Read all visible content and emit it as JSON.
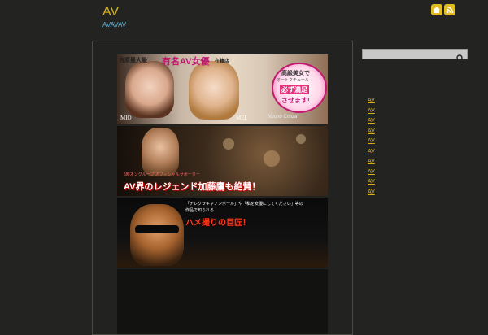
{
  "header": {
    "title": "AV",
    "tagline": "AVAVAV"
  },
  "icons": [
    "home-icon",
    "rss-icon"
  ],
  "banners": [
    {
      "headline_left": "吉原最大級",
      "headline_main": "有名AV女優",
      "headline_tail": "在籍店",
      "name_left": "MIO",
      "name_right": "MEI",
      "badge_top": "高級美女で",
      "badge_mid": "オートクチュール",
      "badge_accent": "必ず満足",
      "badge_bottom": "させます!",
      "shop_name": "Nuuno Cmiza"
    },
    {
      "caption_small": "5時オングループ オフィシャルサポーター",
      "headline": "AV界のレジェンド加藤鷹も絶賛！"
    },
    {
      "caption_line1": "「チレクラキャノンボール」や「私を女優にしてください」等の",
      "caption_line2": "作品で知られる",
      "headline": "ハメ撮りの巨匠！"
    }
  ],
  "sidebar": {
    "search_placeholder": "",
    "links": [
      "AV",
      "AV",
      "AV",
      "AV",
      "AV",
      "AV",
      "AV",
      "AV",
      "AV",
      "AV"
    ]
  },
  "colors": {
    "background": "#232321",
    "accent": "#d4b21d",
    "tagline": "#5fb7de"
  }
}
